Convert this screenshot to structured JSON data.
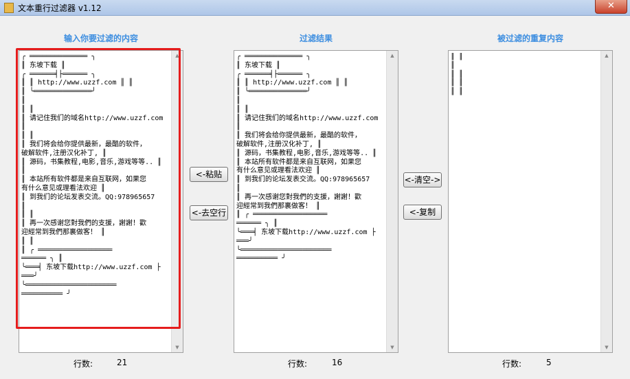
{
  "window": {
    "title": "文本重行过滤器 v1.12",
    "close_glyph": "✕"
  },
  "columns": {
    "input_label": "输入你要过滤的内容",
    "result_label": "过滤结果",
    "duplicate_label": "被过滤的重复内容"
  },
  "input_text": "╭ ══════════════ ╮\n║ 东坡下载 ║\n╭ ══════╡├══════ ╮\n║ ║ http://www.uzzf.com ║ ║\n║ ╰══════════════╯\n║\n║ ║\n║ 请记住我们的域名http://www.uzzf.com\n║\n║ ║\n║ 我们将会给你提供最新，最酷的软件，\n破解软件,注册汉化补丁, ║\n║ 源码，书集教程,电影,音乐,游戏等等.. ║\n║\n║ 本站所有软件都是来自互联网，如果您\n有什么意见或理看法欢迎 ║\n║ 到我们的论坛发表交流。QQ:978965657\n║\n║ ║\n║ 再一次感谢您對我們的支援，謝謝！歡\n迎經常到我們那裏做客！ ║\n║ ║\n║ ╭ ══════════════════\n══════ ╮ ║\n╰═══╡ 东坡下载http://www.uzzf.com ├\n═══╯\n╰══════════════════════\n══════════ ╯",
  "result_text": "╭ ══════════════ ╮\n║ 东坡下载 ║\n╭ ══════╡├══════ ╮\n║ ║ http://www.uzzf.com ║ ║\n║ ╰══════════════╯\n║\n║ ║\n║ 请记住我们的域名http://www.uzzf.com\n║\n║ 我们将会给你提供最新，最酷的软件，\n破解软件,注册汉化补丁, ║\n║ 源码，书集教程,电影,音乐,游戏等等.. ║\n║ 本站所有软件都是来自互联网，如果您\n有什么意见或理看法欢迎 ║\n║ 到我们的论坛发表交流。QQ:978965657\n║\n║ 再一次感谢您對我們的支援，謝謝！歡\n迎經常到我們那裏做客！ ║\n║ ╭ ══════════════════\n══════ ╮ ║\n╰═══╡ 东坡下载http://www.uzzf.com ├\n═══╯\n╰══════════════════════\n══════════ ╯",
  "duplicate_text": "║ ║\n║\n║ ║\n║ ║\n║ ║",
  "buttons": {
    "paste": "<-粘贴",
    "remove_empty": "<-去空行",
    "clear": "<-清空->",
    "copy": "<-复制"
  },
  "counts": {
    "label": "行数:",
    "input": "21",
    "result": "16",
    "duplicate": "5"
  }
}
